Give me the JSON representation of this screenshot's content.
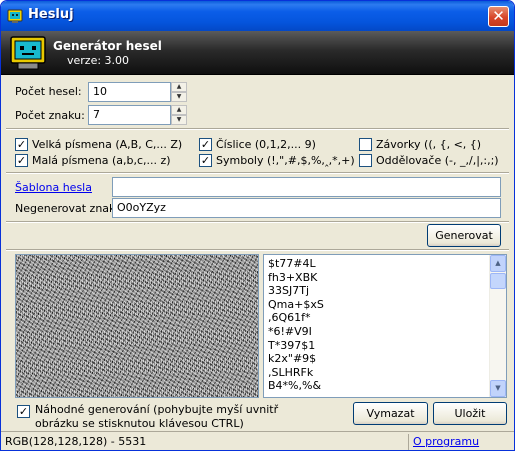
{
  "window": {
    "title": "Hesluj",
    "close_label": "✕"
  },
  "header": {
    "title": "Generátor hesel",
    "version": "verze: 3.00"
  },
  "settings": {
    "count_label": "Počet hesel:",
    "count_value": "10",
    "length_label": "Počet znaku:",
    "length_value": "7"
  },
  "options": {
    "uppercase": {
      "label": "Velká písmena (A,B, C,... Z)",
      "checked": true
    },
    "lowercase": {
      "label": "Malá písmena (a,b,c,... z)",
      "checked": true
    },
    "digits": {
      "label": "Číslice (0,1,2,... 9)",
      "checked": true
    },
    "symbols": {
      "label": "Symboly (!,\",#,$,%,‸,*,+)",
      "checked": true
    },
    "brackets": {
      "label": "Závorky ((, {, <, {)",
      "checked": false
    },
    "separators": {
      "label": "Oddělovače (-, _,/,|,:,;)",
      "checked": false
    }
  },
  "template": {
    "label": "Šablona hesla",
    "value": ""
  },
  "exclude": {
    "label": "Negenerovat znaky",
    "value": "O0oYZyz"
  },
  "buttons": {
    "generate": "Generovat",
    "clear": "Vymazat",
    "save": "Uložit"
  },
  "passwords": [
    "$t77#4L",
    "fh3+XBK",
    "33SJ7Tj",
    "Qma+$xS",
    ",6Q61f*",
    "*6!#V9I",
    "T*397$1",
    "k2x\"#9$",
    ",SLHRFk",
    "B4*%,%&"
  ],
  "random": {
    "label_line1": "Náhodné generování (pohybujte myší uvnitř",
    "label_line2": "obrázku se stisknutou klávesou CTRL)",
    "checked": true
  },
  "status": {
    "left": "RGB(128,128,128) - 5531",
    "link": "O programu"
  }
}
